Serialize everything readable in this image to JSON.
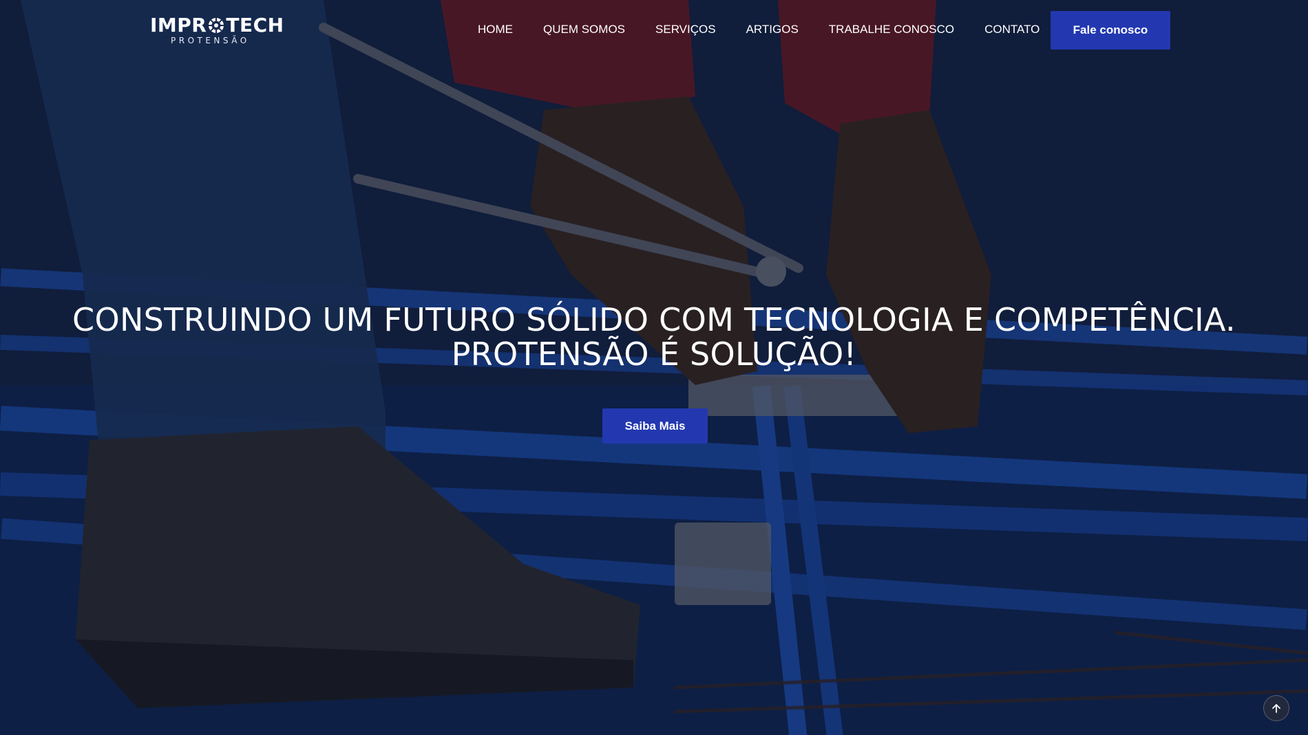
{
  "brand": {
    "name_part1": "IMPR",
    "name_part2": "TECH",
    "tagline": "PROTENSÃO",
    "gear_icon": "gear-icon"
  },
  "nav": {
    "items": [
      {
        "label": "HOME"
      },
      {
        "label": "QUEM SOMOS"
      },
      {
        "label": "SERVIÇOS"
      },
      {
        "label": "ARTIGOS"
      },
      {
        "label": "TRABALHE CONOSCO"
      },
      {
        "label": "CONTATO"
      }
    ],
    "cta_label": "Fale conosco"
  },
  "hero": {
    "headline_line1": "CONSTRUINDO UM FUTURO SÓLIDO COM TECNOLOGIA E COMPETÊNCIA.",
    "headline_line2": "PROTENSÃO É SOLUÇÃO!",
    "cta_label": "Saiba Mais"
  },
  "scroll_top": {
    "icon": "arrow-up-icon"
  },
  "colors": {
    "accent": "#2338b0",
    "text": "#ffffff",
    "background": "#13254d"
  }
}
